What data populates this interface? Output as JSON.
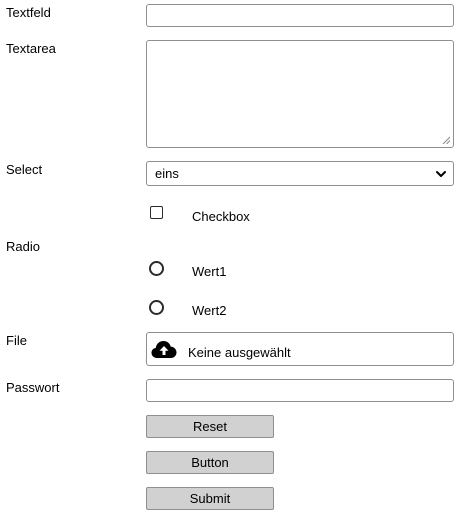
{
  "form": {
    "textfield": {
      "label": "Textfeld",
      "value": ""
    },
    "textarea": {
      "label": "Textarea",
      "value": ""
    },
    "select": {
      "label": "Select",
      "value": "eins"
    },
    "checkbox": {
      "label": "Checkbox",
      "checked": false
    },
    "radio": {
      "label": "Radio",
      "options": [
        {
          "label": "Wert1",
          "checked": false
        },
        {
          "label": "Wert2",
          "checked": false
        }
      ]
    },
    "file": {
      "label": "File",
      "status": "Keine ausgewählt",
      "icon": "cloud-upload-icon"
    },
    "password": {
      "label": "Passwort",
      "value": ""
    },
    "buttons": {
      "reset": "Reset",
      "button": "Button",
      "submit": "Submit"
    }
  }
}
